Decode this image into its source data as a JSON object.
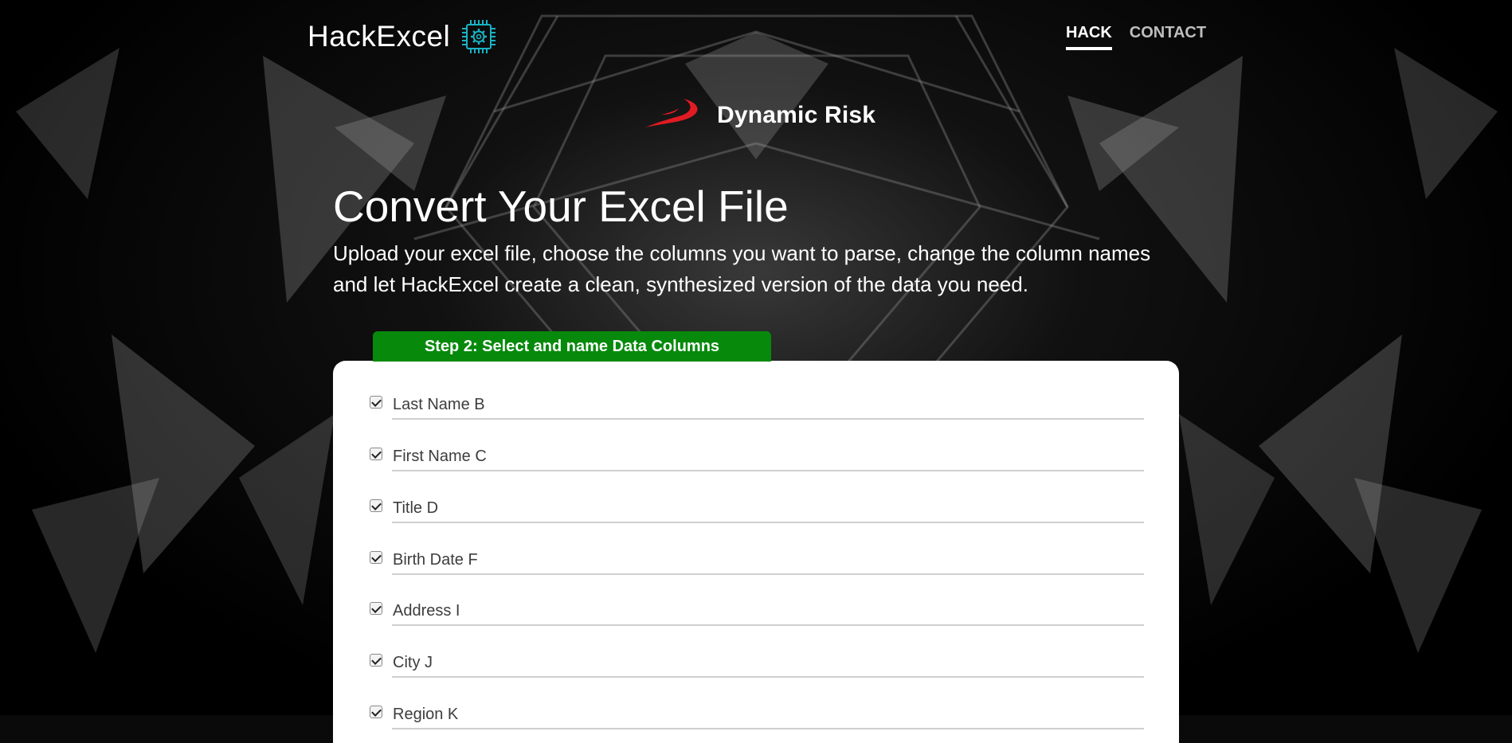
{
  "header": {
    "brand": "HackExcel",
    "nav": [
      {
        "label": "HACK",
        "active": true
      },
      {
        "label": "CONTACT",
        "active": false
      }
    ]
  },
  "logo": {
    "text": "Dynamic Risk",
    "mark_color": "#e01b22"
  },
  "hero": {
    "title": "Convert Your Excel File",
    "description": "Upload your excel file, choose the columns you want to parse, change the column names and let HackExcel create a clean, synthesized version of the data you need."
  },
  "step": {
    "label": "Step 2: Select and name Data Columns",
    "color": "#078a0c"
  },
  "columns": [
    {
      "name": "Last Name B",
      "checked": true
    },
    {
      "name": "First Name C",
      "checked": true
    },
    {
      "name": "Title D",
      "checked": true
    },
    {
      "name": "Birth Date F",
      "checked": true
    },
    {
      "name": "Address I",
      "checked": true
    },
    {
      "name": "City J",
      "checked": true
    },
    {
      "name": "Region K",
      "checked": true
    }
  ]
}
